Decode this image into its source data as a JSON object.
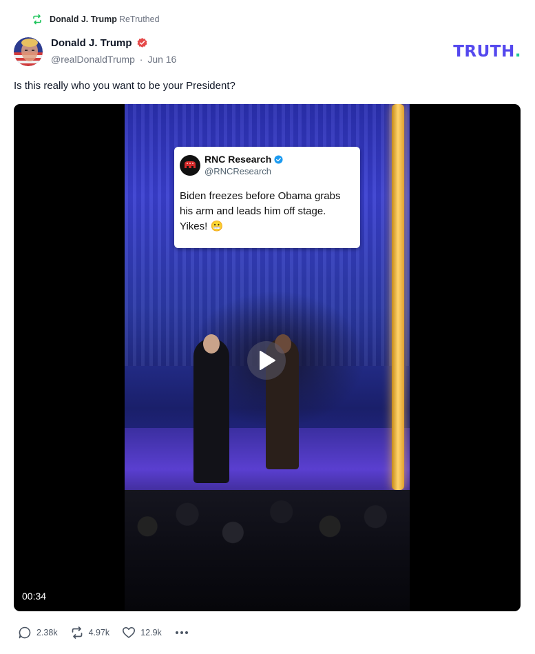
{
  "retruth": {
    "name": "Donald J. Trump",
    "action": "ReTruthed"
  },
  "author": {
    "name": "Donald J. Trump",
    "handle": "@realDonaldTrump",
    "separator": "·",
    "date": "Jun 16"
  },
  "brand": {
    "text": "TRUTH",
    "dot": ".",
    "color": "#5448ee",
    "dot_color": "#20c997"
  },
  "post": {
    "text": "Is this really who you want to be your President?"
  },
  "video": {
    "duration": "00:34",
    "embedded_card": {
      "name": "RNC Research",
      "handle": "@RNCResearch",
      "text": "Biden freezes before Obama grabs his arm and leads him off stage. Yikes! 😬"
    }
  },
  "actions": {
    "replies": "2.38k",
    "retruths": "4.97k",
    "likes": "12.9k"
  },
  "icons": {
    "retruth": "retruth-icon",
    "verified": "verified-badge-icon",
    "reply": "reply-icon",
    "like": "heart-icon",
    "more": "more-icon",
    "play": "play-icon"
  },
  "colors": {
    "retruth_green": "#22c55e",
    "verified_red": "#e54a4a",
    "text_muted": "#6b7280"
  }
}
